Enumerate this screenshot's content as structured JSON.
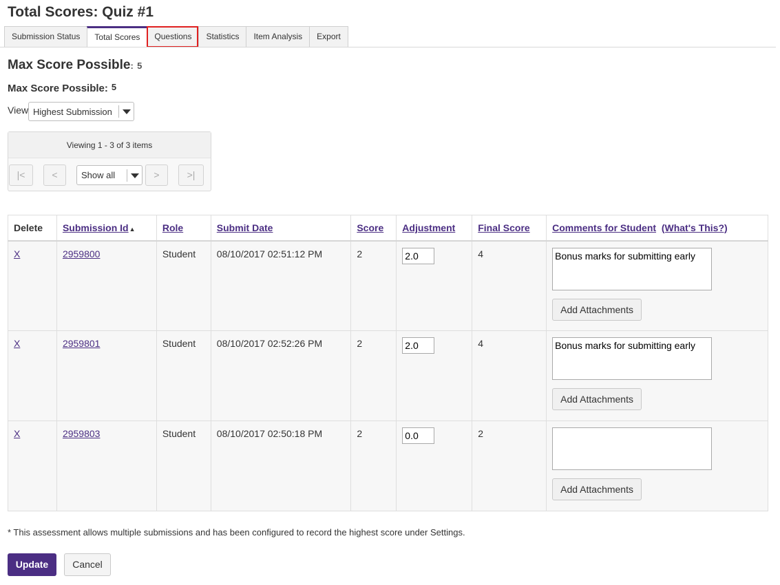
{
  "page": {
    "title": "Total Scores: Quiz #1"
  },
  "tabs": [
    {
      "label": "Submission Status"
    },
    {
      "label": "Total Scores"
    },
    {
      "label": "Questions"
    },
    {
      "label": "Statistics"
    },
    {
      "label": "Item Analysis"
    },
    {
      "label": "Export"
    }
  ],
  "max_score": {
    "large_label": "Max Score Possible",
    "large_sep": ":",
    "large_value": "5",
    "small_label": "Max Score Possible:",
    "small_value": "5"
  },
  "view": {
    "label": "View",
    "selected": "Highest Submission"
  },
  "pager": {
    "status": "Viewing 1 - 3 of 3 items",
    "first": "|<",
    "prev": "<",
    "page_size": "Show all",
    "next": ">",
    "last": ">|"
  },
  "table": {
    "headers": {
      "delete": "Delete",
      "submission_id": "Submission Id",
      "sort_arrow": "▲",
      "role": "Role",
      "submit_date": "Submit Date",
      "score": "Score",
      "adjustment": "Adjustment",
      "final_score": "Final Score",
      "comments": "Comments for Student",
      "whats_this": "(What's This?)"
    },
    "rows": [
      {
        "delete": "X",
        "submission_id": "2959800",
        "role": "Student",
        "submit_date": "08/10/2017 02:51:12 PM",
        "score": "2",
        "adjustment": "2.0",
        "final_score": "4",
        "comment": "Bonus marks for submitting early",
        "attach_label": "Add Attachments"
      },
      {
        "delete": "X",
        "submission_id": "2959801",
        "role": "Student",
        "submit_date": "08/10/2017 02:52:26 PM",
        "score": "2",
        "adjustment": "2.0",
        "final_score": "4",
        "comment": "Bonus marks for submitting early",
        "attach_label": "Add Attachments"
      },
      {
        "delete": "X",
        "submission_id": "2959803",
        "role": "Student",
        "submit_date": "08/10/2017 02:50:18 PM",
        "score": "2",
        "adjustment": "0.0",
        "final_score": "2",
        "comment": "",
        "attach_label": "Add Attachments"
      }
    ]
  },
  "footnote": "* This assessment allows multiple submissions and has been configured to record the highest score under Settings.",
  "actions": {
    "update": "Update",
    "cancel": "Cancel"
  },
  "colors": {
    "accent": "#4b2e83",
    "highlight": "#e02020"
  }
}
